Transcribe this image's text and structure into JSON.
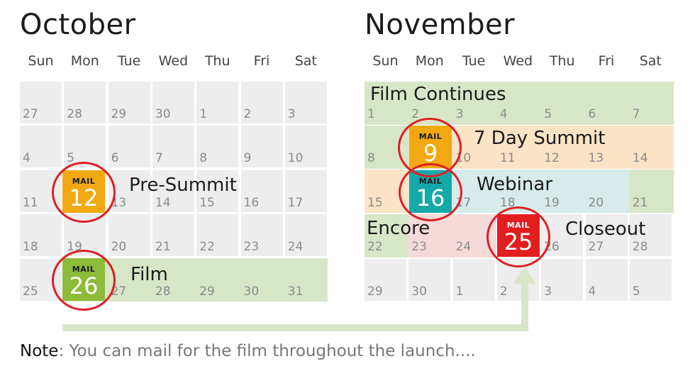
{
  "days_of_week": [
    "Sun",
    "Mon",
    "Tue",
    "Wed",
    "Thu",
    "Fri",
    "Sat"
  ],
  "colors": {
    "cell_bg": "#ededed",
    "green_band": "#d8e6c8",
    "orange_band": "#fbe3c5",
    "teal_band": "#d6ebea",
    "pink_band": "#f6dada",
    "ring": "#dd1f25",
    "arrow": "#d9e5c9",
    "tile_orange": "#f2a911",
    "tile_green": "#8dbb3a",
    "tile_teal": "#14a9a8",
    "tile_red": "#e21e1e"
  },
  "october": {
    "title": "October",
    "weeks": [
      [
        "27",
        "28",
        "29",
        "30",
        "1",
        "2",
        "3"
      ],
      [
        "4",
        "5",
        "6",
        "7",
        "8",
        "9",
        "10"
      ],
      [
        "11",
        "12",
        "13",
        "14",
        "15",
        "16",
        "17"
      ],
      [
        "18",
        "19",
        "20",
        "21",
        "22",
        "23",
        "24"
      ],
      [
        "25",
        "26",
        "27",
        "28",
        "29",
        "30",
        "31"
      ]
    ],
    "events": [
      {
        "label": "Pre-Summit",
        "mail_day": "12",
        "mail_label": "MAIL",
        "tile_color": "orange"
      },
      {
        "label": "Film",
        "mail_day": "26",
        "mail_label": "MAIL",
        "tile_color": "green"
      }
    ]
  },
  "november": {
    "title": "November",
    "weeks": [
      [
        "1",
        "2",
        "3",
        "4",
        "5",
        "6",
        "7"
      ],
      [
        "8",
        "9",
        "10",
        "11",
        "12",
        "13",
        "14"
      ],
      [
        "15",
        "16",
        "17",
        "18",
        "19",
        "20",
        "21"
      ],
      [
        "22",
        "23",
        "24",
        "25",
        "26",
        "27",
        "28"
      ],
      [
        "29",
        "30",
        "1",
        "2",
        "3",
        "4",
        "5"
      ]
    ],
    "events": [
      {
        "label": "Film Continues"
      },
      {
        "label": "7 Day Summit",
        "mail_day": "9",
        "mail_label": "MAIL",
        "tile_color": "orange"
      },
      {
        "label": "Webinar",
        "mail_day": "16",
        "mail_label": "MAIL",
        "tile_color": "teal"
      },
      {
        "label": "Encore"
      },
      {
        "label": "Closeout",
        "mail_day": "25",
        "mail_label": "MAIL",
        "tile_color": "red"
      }
    ]
  },
  "note": {
    "prefix": "Note",
    "text": ": You can mail for the film throughout the launch...."
  }
}
